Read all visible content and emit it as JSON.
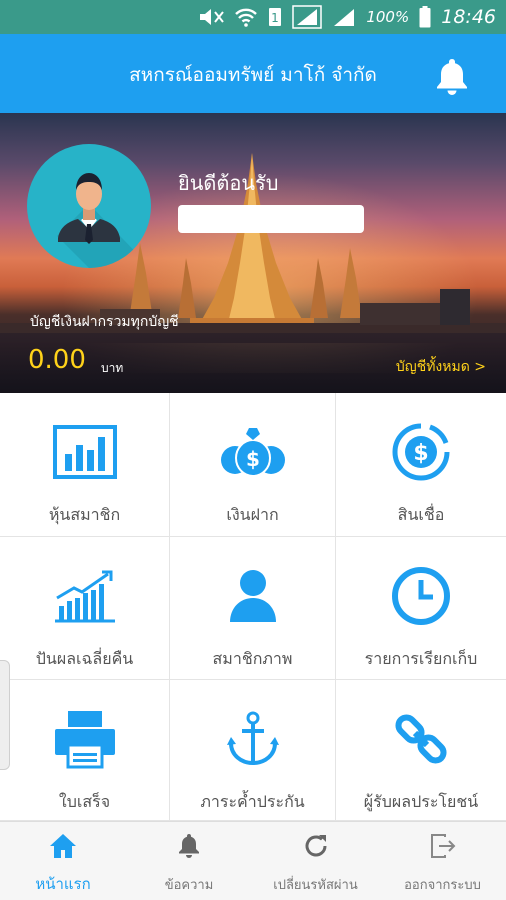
{
  "status_bar": {
    "battery_percent": "100%",
    "time": "18:46",
    "icons": [
      "mute-icon",
      "wifi-icon",
      "sim1-icon",
      "signal-icon",
      "signal-icon",
      "battery-icon"
    ]
  },
  "app_bar": {
    "title": "สหกรณ์ออมทรัพย์ มาโก้ จำกัด",
    "bell_icon": "bell-icon"
  },
  "banner": {
    "welcome": "ยินดีต้อนรับ",
    "account_label": "บัญชีเงินฝากรวมทุกบัญชี",
    "balance": "0.00",
    "currency": "บาท",
    "all_accounts_link": "บัญชีทั้งหมด >"
  },
  "menu": {
    "items": [
      {
        "label": "หุ้นสมาชิก",
        "icon": "bar-chart-icon"
      },
      {
        "label": "เงินฝาก",
        "icon": "money-bags-icon"
      },
      {
        "label": "สินเชื่อ",
        "icon": "dollar-coin-icon"
      },
      {
        "label": "ปันผลเฉลี่ยคืน",
        "icon": "growth-chart-icon"
      },
      {
        "label": "สมาชิกภาพ",
        "icon": "person-icon"
      },
      {
        "label": "รายการเรียกเก็บ",
        "icon": "clock-icon"
      },
      {
        "label": "ใบเสร็จ",
        "icon": "printer-icon"
      },
      {
        "label": "ภาระค้ำประกัน",
        "icon": "anchor-icon"
      },
      {
        "label": "ผู้รับผลประโยชน์",
        "icon": "chain-link-icon"
      }
    ]
  },
  "bottom_nav": {
    "items": [
      {
        "label": "หน้าแรก",
        "icon": "home-icon",
        "active": true
      },
      {
        "label": "ข้อความ",
        "icon": "bell-icon",
        "active": false
      },
      {
        "label": "เปลี่ยนรหัสผ่าน",
        "icon": "refresh-icon",
        "active": false
      },
      {
        "label": "ออกจากระบบ",
        "icon": "logout-icon",
        "active": false
      }
    ]
  },
  "colors": {
    "primary": "#1e9ff0",
    "accent_yellow": "#ffd21a",
    "avatar_bg": "#27b3c8",
    "status_bar": "#3a9a8a"
  }
}
